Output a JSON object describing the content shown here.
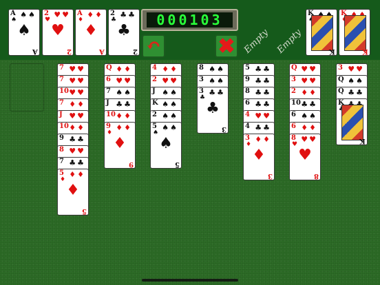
{
  "timer": {
    "digits": "000103"
  },
  "buttons": {
    "undo_icon": "undo-arrow-icon",
    "close_icon": "close-icon",
    "undo_glyph": "↶",
    "close_glyph": "✖"
  },
  "empty_label": "Empty",
  "colors": {
    "felt": "#2c6b26",
    "topbar": "#155a1b",
    "lcd_text": "#29ff3a",
    "red_suit": "#e01010"
  },
  "top_row": {
    "freecells": [
      {
        "rank": "A",
        "suit": "♠",
        "color": "blk"
      },
      {
        "rank": "2",
        "suit": "♥",
        "color": "red"
      },
      {
        "rank": "A",
        "suit": "♦",
        "color": "red"
      },
      {
        "rank": "2",
        "suit": "♣",
        "color": "blk"
      }
    ],
    "foundations": [
      {
        "label": "Empty"
      },
      {
        "label": "Empty"
      },
      {
        "rank": "K",
        "suit": "♠",
        "color": "blk",
        "face": true
      },
      {
        "rank": "K",
        "suit": "♦",
        "color": "red",
        "face": true
      }
    ]
  },
  "tableau": [
    [
      {
        "rank": "7",
        "suit": "♥",
        "color": "red"
      },
      {
        "rank": "7",
        "suit": "♥",
        "color": "red"
      },
      {
        "rank": "10",
        "suit": "♥",
        "color": "red"
      },
      {
        "rank": "7",
        "suit": "♦",
        "color": "red"
      },
      {
        "rank": "J",
        "suit": "♥",
        "color": "red"
      },
      {
        "rank": "10",
        "suit": "♦",
        "color": "red"
      },
      {
        "rank": "9",
        "suit": "♣",
        "color": "blk"
      },
      {
        "rank": "8",
        "suit": "♥",
        "color": "red"
      },
      {
        "rank": "7",
        "suit": "♣",
        "color": "blk"
      },
      {
        "rank": "5",
        "suit": "♦",
        "color": "red"
      }
    ],
    [
      {
        "rank": "Q",
        "suit": "♦",
        "color": "red"
      },
      {
        "rank": "6",
        "suit": "♥",
        "color": "red"
      },
      {
        "rank": "7",
        "suit": "♠",
        "color": "blk"
      },
      {
        "rank": "J",
        "suit": "♣",
        "color": "blk"
      },
      {
        "rank": "10",
        "suit": "♦",
        "color": "red"
      },
      {
        "rank": "9",
        "suit": "♦",
        "color": "red"
      }
    ],
    [
      {
        "rank": "4",
        "suit": "♦",
        "color": "red"
      },
      {
        "rank": "2",
        "suit": "♥",
        "color": "red"
      },
      {
        "rank": "J",
        "suit": "♠",
        "color": "blk"
      },
      {
        "rank": "K",
        "suit": "♠",
        "color": "blk"
      },
      {
        "rank": "2",
        "suit": "♠",
        "color": "blk"
      },
      {
        "rank": "5",
        "suit": "♠",
        "color": "blk"
      }
    ],
    [
      {
        "rank": "8",
        "suit": "♠",
        "color": "blk"
      },
      {
        "rank": "3",
        "suit": "♠",
        "color": "blk"
      },
      {
        "rank": "3",
        "suit": "♣",
        "color": "blk"
      }
    ],
    [
      {
        "rank": "5",
        "suit": "♣",
        "color": "blk"
      },
      {
        "rank": "9",
        "suit": "♣",
        "color": "blk"
      },
      {
        "rank": "8",
        "suit": "♣",
        "color": "blk"
      },
      {
        "rank": "6",
        "suit": "♣",
        "color": "blk"
      },
      {
        "rank": "4",
        "suit": "♥",
        "color": "red"
      },
      {
        "rank": "4",
        "suit": "♣",
        "color": "blk"
      },
      {
        "rank": "3",
        "suit": "♦",
        "color": "red"
      }
    ],
    [
      {
        "rank": "Q",
        "suit": "♥",
        "color": "red"
      },
      {
        "rank": "3",
        "suit": "♥",
        "color": "red"
      },
      {
        "rank": "2",
        "suit": "♦",
        "color": "red"
      },
      {
        "rank": "10",
        "suit": "♣",
        "color": "blk"
      },
      {
        "rank": "6",
        "suit": "♠",
        "color": "blk"
      },
      {
        "rank": "6",
        "suit": "♦",
        "color": "red"
      },
      {
        "rank": "8",
        "suit": "♥",
        "color": "red"
      }
    ],
    [
      {
        "rank": "3",
        "suit": "♥",
        "color": "red"
      },
      {
        "rank": "Q",
        "suit": "♠",
        "color": "blk"
      },
      {
        "rank": "Q",
        "suit": "♣",
        "color": "blk"
      },
      {
        "rank": "K",
        "suit": "♣",
        "color": "blk",
        "face": true
      }
    ]
  ]
}
